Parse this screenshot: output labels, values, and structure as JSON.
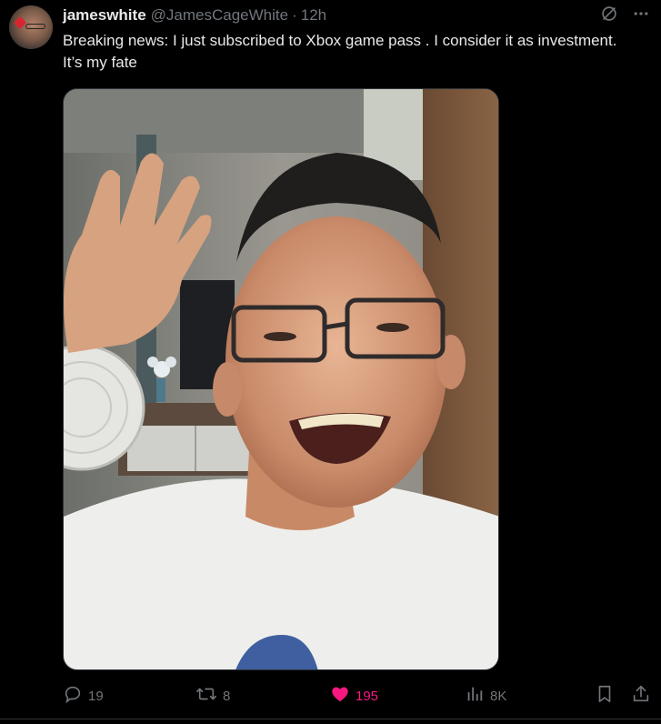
{
  "author": {
    "display_name": "jameswhite",
    "handle": "@JamesCageWhite",
    "separator": "·",
    "timestamp": "12h"
  },
  "tweet": {
    "text": "Breaking news: I just subscribed to Xbox game pass . I consider it as investment. It’s my fate"
  },
  "media": {
    "type": "photo"
  },
  "header_icons": [
    "grok-slash-icon",
    "more-icon"
  ],
  "actions": {
    "replies": "19",
    "reposts": "8",
    "likes": "195",
    "views": "8K"
  },
  "colors": {
    "background": "#000000",
    "text_primary": "#e7e9ea",
    "text_secondary": "#71767b",
    "like_accent": "#f91880",
    "border": "#2f3336"
  }
}
